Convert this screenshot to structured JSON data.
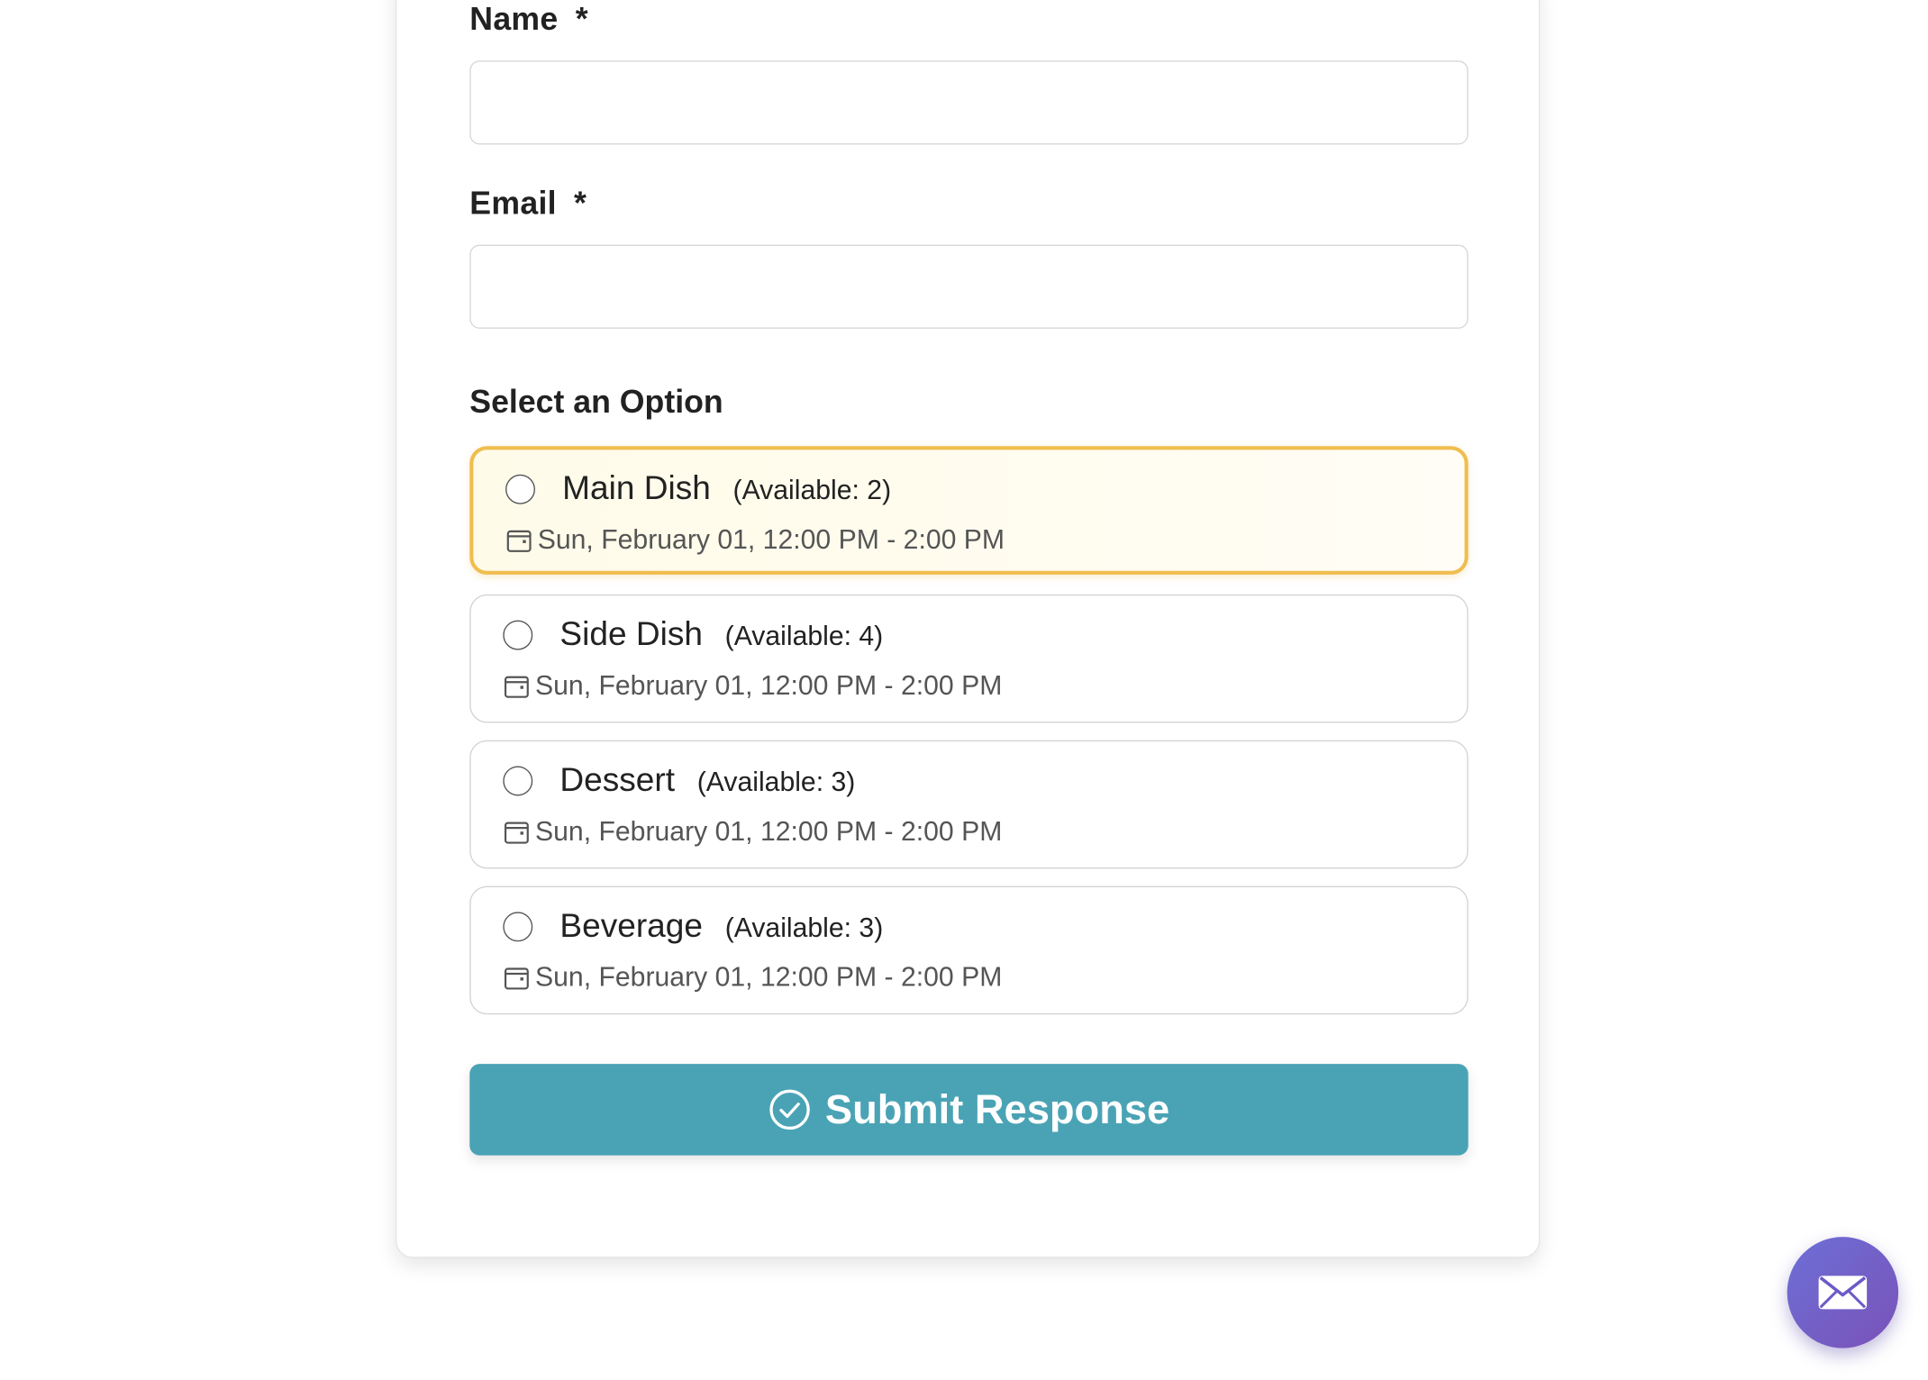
{
  "form": {
    "name_label": "Name",
    "name_required": "*",
    "name_value": "",
    "email_label": "Email",
    "email_required": "*",
    "email_value": "",
    "options_title": "Select an Option",
    "options": [
      {
        "name": "Main Dish",
        "availability": "(Available: 2)",
        "date": "Sun, February 01, 12:00 PM - 2:00 PM",
        "selected_highlight": true
      },
      {
        "name": "Side Dish",
        "availability": "(Available: 4)",
        "date": "Sun, February 01, 12:00 PM - 2:00 PM",
        "selected_highlight": false
      },
      {
        "name": "Dessert",
        "availability": "(Available: 3)",
        "date": "Sun, February 01, 12:00 PM - 2:00 PM",
        "selected_highlight": false
      },
      {
        "name": "Beverage",
        "availability": "(Available: 3)",
        "date": "Sun, February 01, 12:00 PM - 2:00 PM",
        "selected_highlight": false
      }
    ],
    "submit_label": "Submit Response",
    "submit_icon": "check-circle-icon"
  },
  "fab": {
    "icon": "envelope-icon"
  },
  "colors": {
    "accent": "#4aa3b5",
    "highlight_border": "#f0bd4e",
    "fab_start": "#6c6fd6",
    "fab_end": "#7a52b8"
  }
}
